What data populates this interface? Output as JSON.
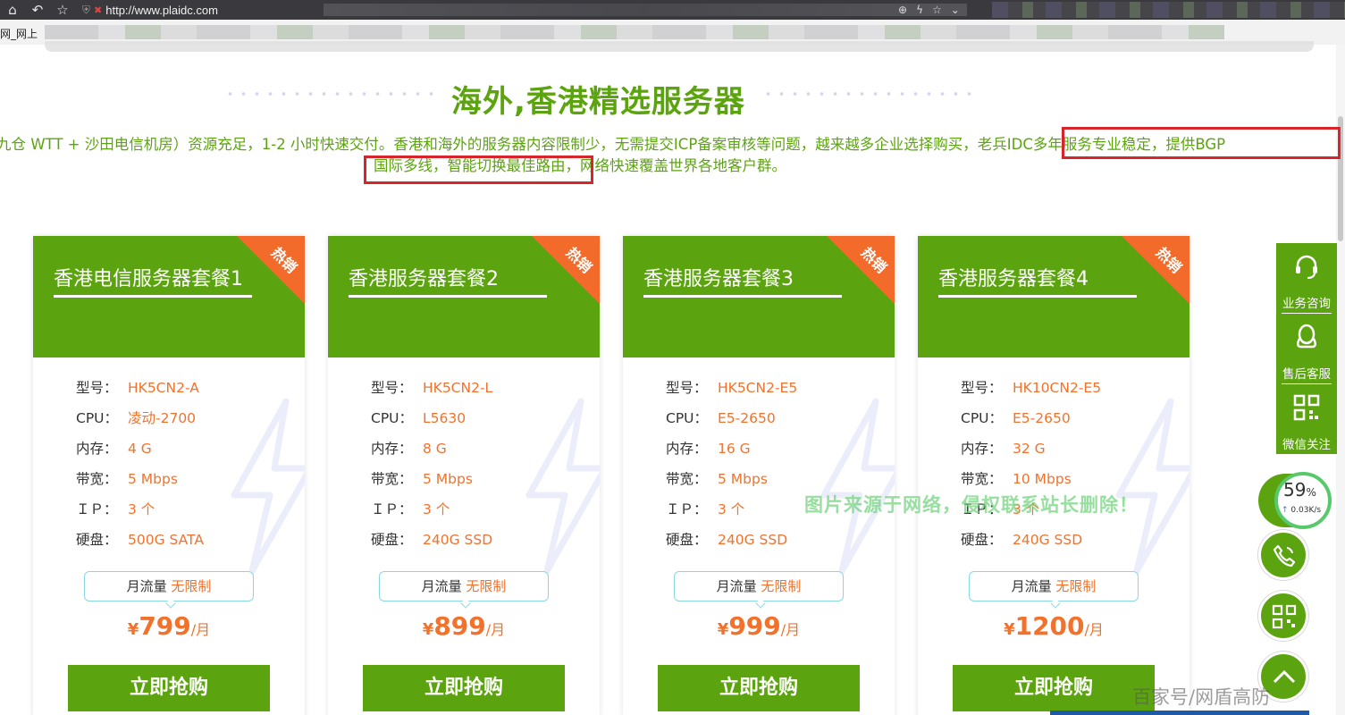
{
  "browser": {
    "url": "http://www.plaidc.com",
    "bookmark_label": "网_网上"
  },
  "section": {
    "title": "海外,香港精选服务器",
    "intro_line1": "九仓 WTT + 沙田电信机房）资源充足，1-2 小时快速交付。香港和海外的服务器内容限制少，无需提交ICP备案审核等问题，越来越多企业选择购买，老兵IDC多年服务专业稳定，提供BGP",
    "intro_line2": "国际多线，智能切换最佳路由，网络快速覆盖世界各地客户群。"
  },
  "labels": {
    "model": "型号：",
    "cpu": "CPU：",
    "memory": "内存：",
    "bandwidth": "带宽：",
    "ip": "ＩＰ：",
    "disk": "硬盘：",
    "hot": "热销",
    "traffic_label": "月流量",
    "traffic_value": "无限制",
    "currency": "¥",
    "unit": "/月",
    "buy": "立即抢购"
  },
  "cards": [
    {
      "title": "香港电信服务器套餐1",
      "model": "HK5CN2-A",
      "cpu": "凌动-2700",
      "memory": "4 G",
      "bandwidth": "5 Mbps",
      "ip": "3 个",
      "disk": "500G SATA",
      "price": "799"
    },
    {
      "title": "香港服务器套餐2",
      "model": "HK5CN2-L",
      "cpu": "L5630",
      "memory": "8 G",
      "bandwidth": "5 Mbps",
      "ip": "3 个",
      "disk": "240G SSD",
      "price": "899"
    },
    {
      "title": "香港服务器套餐3",
      "model": "HK5CN2-E5",
      "cpu": "E5-2650",
      "memory": "16 G",
      "bandwidth": "5 Mbps",
      "ip": "3 个",
      "disk": "240G SSD",
      "price": "999"
    },
    {
      "title": "香港服务器套餐4",
      "model": "HK10CN2-E5",
      "cpu": "E5-2650",
      "memory": "32 G",
      "bandwidth": "10 Mbps",
      "ip": "3 个",
      "disk": "240G SSD",
      "price": "1200"
    }
  ],
  "side_panel": {
    "items": [
      {
        "label": "业务咨询",
        "icon": "headset-icon"
      },
      {
        "label": "售后客服",
        "icon": "qq-penguin-icon"
      },
      {
        "label": "微信关注",
        "icon": "qr-code-icon"
      }
    ]
  },
  "speed": {
    "percent": "59",
    "percent_sign": "%",
    "rate": "0.03K/s"
  },
  "overlay": {
    "watermark": "图片来源于网络，侵权联系站长删除！",
    "baijiahao": "百家号/网盾高防"
  },
  "colors": {
    "brand_green": "#5ca40f",
    "accent_orange": "#f2722c",
    "highlight_red": "#d6262b"
  }
}
